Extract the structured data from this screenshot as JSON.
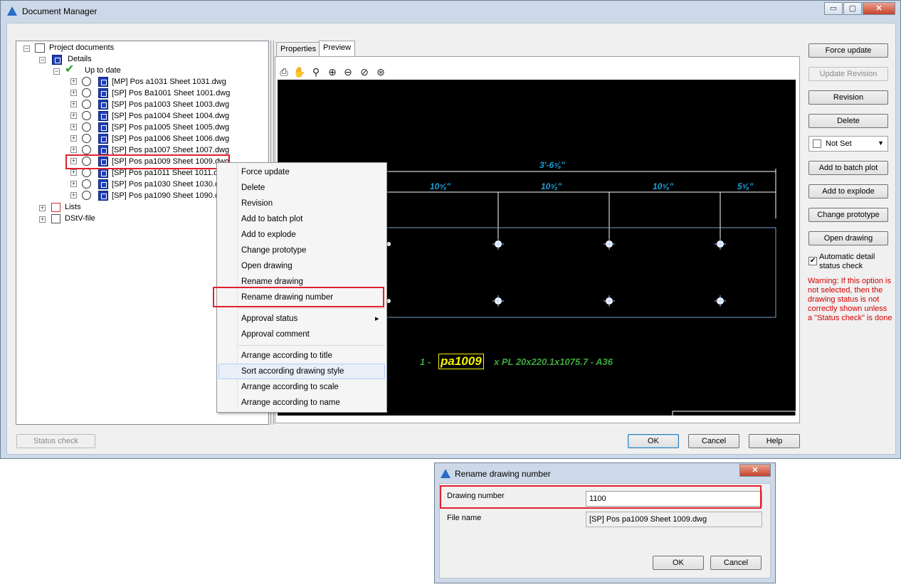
{
  "window": {
    "title": "Document Manager",
    "minimize": "▭",
    "maximize": "▢",
    "close": "✕"
  },
  "tree": {
    "root": "Project documents",
    "details": "Details",
    "up_to_date": "Up to date",
    "drawings": [
      "[MP] Pos a1031 Sheet 1031.dwg",
      "[SP] Pos Ba1001 Sheet 1001.dwg",
      "[SP] Pos pa1003 Sheet 1003.dwg",
      "[SP] Pos pa1004 Sheet 1004.dwg",
      "[SP] Pos pa1005 Sheet 1005.dwg",
      "[SP] Pos pa1006 Sheet 1006.dwg",
      "[SP] Pos pa1007 Sheet 1007.dwg",
      "[SP] Pos pa1009 Sheet 1009.dwg",
      "[SP] Pos pa1011 Sheet 1011.dwg",
      "[SP] Pos pa1030 Sheet 1030.dwg",
      "[SP] Pos pa1090 Sheet 1090.dwg"
    ],
    "lists": "Lists",
    "dstv": "DStV-file"
  },
  "tabs": [
    "Properties",
    "Preview"
  ],
  "preview": {
    "toolbar_icons": [
      "print-icon",
      "pan-icon",
      "zoom-realtime-icon",
      "zoom-in-icon",
      "zoom-out-icon",
      "zoom-window-icon",
      "zoom-extents-icon"
    ],
    "dim_total": "3'-6⅝\"",
    "dim_segments": [
      "10⅝\"",
      "10⅝\"",
      "10⅝\"",
      "5⅝\""
    ],
    "label_prefix": "1 -",
    "label_highlight": "pa1009",
    "label_suffix": "x PL 20x220.1x1075.7 - A36"
  },
  "right_buttons": {
    "force_update": "Force update",
    "update_revision": "Update Revision",
    "revision": "Revision",
    "delete": "Delete",
    "combo_value": "Not Set",
    "add_batch": "Add to batch plot",
    "add_explode": "Add to explode",
    "change_prototype": "Change prototype",
    "open_drawing": "Open drawing",
    "auto_check": "Automatic detail status check",
    "warning": "Warning: If this option is not selected, then the drawing status is not correctly shown unless a \"Status check\" is done"
  },
  "bottom": {
    "status_check": "Status check",
    "ok": "OK",
    "cancel": "Cancel",
    "help": "Help"
  },
  "context_menu": {
    "items_a": [
      "Force update",
      "Delete",
      "Revision",
      "Add to batch plot",
      "Add to explode",
      "Change prototype",
      "Open drawing",
      "Rename drawing",
      "Rename drawing number"
    ],
    "items_b": [
      "Approval status",
      "Approval comment"
    ],
    "items_c": [
      "Arrange according to title",
      "Sort according drawing style",
      "Arrange according to scale",
      "Arrange according to name"
    ],
    "submenu_arrow": "▸"
  },
  "dialog": {
    "title": "Rename drawing number",
    "close": "✕",
    "drawing_number_label": "Drawing number",
    "drawing_number_value": "1100",
    "file_name_label": "File name",
    "file_name_value": "[SP] Pos pa1009 Sheet 1009.dwg",
    "ok": "OK",
    "cancel": "Cancel"
  },
  "colors": {
    "highlight_red": "#e3202e",
    "dim_blue": "#1e9bd7",
    "label_green": "#3da83d",
    "label_yellow": "#f5f500"
  }
}
